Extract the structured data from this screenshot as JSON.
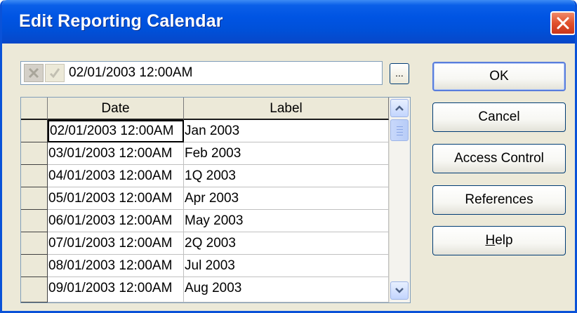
{
  "window": {
    "title": "Edit Reporting Calendar"
  },
  "editor": {
    "value": "02/01/2003 12:00AM",
    "ellipsis_label": "..."
  },
  "grid": {
    "columns": [
      "Date",
      "Label"
    ],
    "rows": [
      {
        "date": "02/01/2003 12:00AM",
        "label": "Jan 2003"
      },
      {
        "date": "03/01/2003 12:00AM",
        "label": "Feb 2003"
      },
      {
        "date": "04/01/2003 12:00AM",
        "label": "1Q 2003"
      },
      {
        "date": "05/01/2003 12:00AM",
        "label": "Apr 2003"
      },
      {
        "date": "06/01/2003 12:00AM",
        "label": "May 2003"
      },
      {
        "date": "07/01/2003 12:00AM",
        "label": "2Q 2003"
      },
      {
        "date": "08/01/2003 12:00AM",
        "label": "Jul 2003"
      },
      {
        "date": "09/01/2003 12:00AM",
        "label": "Aug 2003"
      }
    ]
  },
  "buttons": {
    "ok": "OK",
    "cancel": "Cancel",
    "access_control": "Access Control",
    "references": "References",
    "help_mnemonic": "H",
    "help_rest": "elp"
  },
  "icons": {
    "close": "close-icon",
    "cancel_edit": "x-icon",
    "confirm_edit": "check-icon",
    "scroll_up": "arrow-up-icon",
    "scroll_down": "arrow-down-icon"
  },
  "colors": {
    "titlebar": "#0054e3",
    "dialog": "#ece9d8",
    "close": "#e1502c"
  }
}
